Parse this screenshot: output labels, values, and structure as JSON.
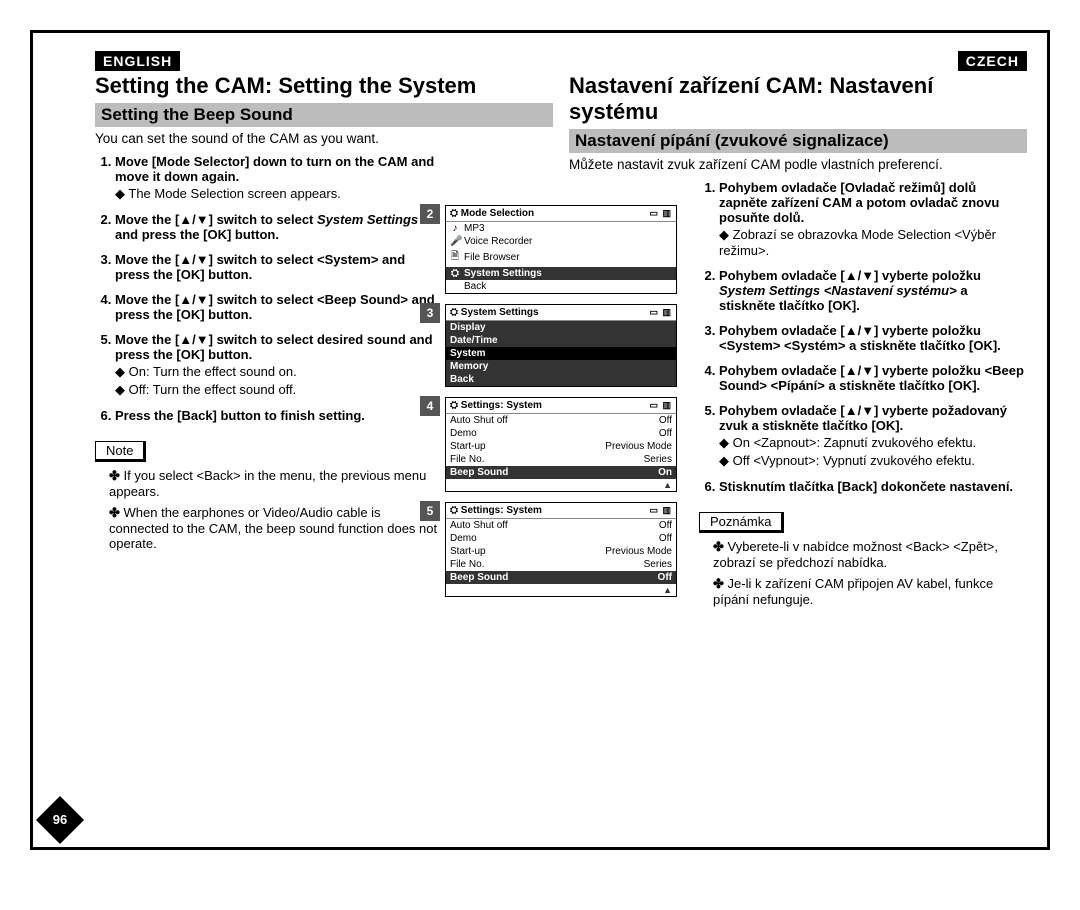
{
  "left": {
    "lang": "ENGLISH",
    "title": "Setting the CAM: Setting the System",
    "subhead": "Setting the Beep Sound",
    "intro": "You can set the sound of the CAM as you want.",
    "steps": [
      {
        "t": "Move [Mode Selector] down to turn on the CAM and move it down again.",
        "sub": "The Mode Selection screen appears."
      },
      {
        "t": "Move the [▲/▼] switch to select",
        "em": "System Settings",
        "t2": " and press the [OK] button."
      },
      {
        "t": "Move the [▲/▼] switch to select <System> and press the [OK] button."
      },
      {
        "t": "Move the [▲/▼] switch to select <Beep Sound> and press the [OK] button."
      },
      {
        "t": "Move the [▲/▼] switch to select desired sound and press the [OK] button.",
        "opts": [
          "On: Turn the effect sound on.",
          "Off: Turn the effect sound off."
        ]
      },
      {
        "t": "Press the [Back] button to finish setting."
      }
    ],
    "note_label": "Note",
    "notes": [
      "If you select <Back> in the menu, the previous menu appears.",
      "When the earphones or Video/Audio cable is connected to the CAM, the beep sound function does not operate."
    ]
  },
  "right": {
    "lang": "CZECH",
    "title": "Nastavení zařízení CAM: Nastavení systému",
    "subhead": "Nastavení pípání (zvukové signalizace)",
    "intro": "Můžete nastavit zvuk zařízení CAM podle vlastních preferencí.",
    "steps": [
      {
        "t": "Pohybem ovladače [Ovladač režimů] dolů zapněte zařízení CAM a potom ovladač znovu posuňte dolů.",
        "sub": "Zobrazí se obrazovka Mode Selection <Výběr režimu>."
      },
      {
        "t": "Pohybem ovladače [▲/▼] vyberte položku",
        "em": "System Settings <Nastavení systému>",
        "t2": " a stiskněte tlačítko [OK]."
      },
      {
        "t": "Pohybem ovladače [▲/▼] vyberte položku <System> <Systém> a stiskněte tlačítko [OK]."
      },
      {
        "t": "Pohybem ovladače [▲/▼] vyberte položku <Beep Sound> <Pípání> a stiskněte tlačítko [OK]."
      },
      {
        "t": "Pohybem ovladače [▲/▼] vyberte požadovaný zvuk a stiskněte tlačítko [OK].",
        "opts": [
          "On <Zapnout>: Zapnutí zvukového efektu.",
          "Off <Vypnout>: Vypnutí zvukového efektu."
        ]
      },
      {
        "t": "Stisknutím tlačítka [Back] dokončete nastavení."
      }
    ],
    "note_label": "Poznámka",
    "notes": [
      "Vyberete-li v nabídce možnost <Back> <Zpět>, zobrazí se předchozí nabídka.",
      "Je-li k zařízení CAM připojen AV kabel, funkce pípání nefunguje."
    ]
  },
  "screens": {
    "s2": {
      "num": "2",
      "title": "Mode Selection",
      "stat": "▭ ▥",
      "rows": [
        {
          "ico": "♪",
          "label": "MP3"
        },
        {
          "ico": "🎤",
          "label": "Voice Recorder"
        },
        {
          "ico": "🗎",
          "label": "File Browser"
        },
        {
          "ico": "⛭",
          "label": "System Settings",
          "hl": true
        },
        {
          "ico": "",
          "label": "Back"
        }
      ]
    },
    "s3": {
      "num": "3",
      "title": "System Settings",
      "stat": "▭ ▥",
      "rows": [
        {
          "label": "Display",
          "hl": true
        },
        {
          "label": "Date/Time",
          "hl": true
        },
        {
          "label": "System",
          "hl": true,
          "strong": true
        },
        {
          "label": "Memory",
          "hl": true
        },
        {
          "label": "Back",
          "hl": true
        }
      ]
    },
    "s4": {
      "num": "4",
      "title": "Settings: System",
      "stat": "▭ ▥",
      "rows": [
        {
          "label": "Auto Shut off",
          "val": "Off"
        },
        {
          "label": "Demo",
          "val": "Off"
        },
        {
          "label": "Start-up",
          "val": "Previous Mode"
        },
        {
          "label": "File No.",
          "val": "Series"
        },
        {
          "label": "Beep Sound",
          "val": "On",
          "hl": true
        }
      ]
    },
    "s5": {
      "num": "5",
      "title": "Settings: System",
      "stat": "▭ ▥",
      "rows": [
        {
          "label": "Auto Shut off",
          "val": "Off"
        },
        {
          "label": "Demo",
          "val": "Off"
        },
        {
          "label": "Start-up",
          "val": "Previous Mode"
        },
        {
          "label": "File No.",
          "val": "Series"
        },
        {
          "label": "Beep Sound",
          "val": "Off",
          "hl": true
        }
      ]
    }
  },
  "pagenum": "96"
}
